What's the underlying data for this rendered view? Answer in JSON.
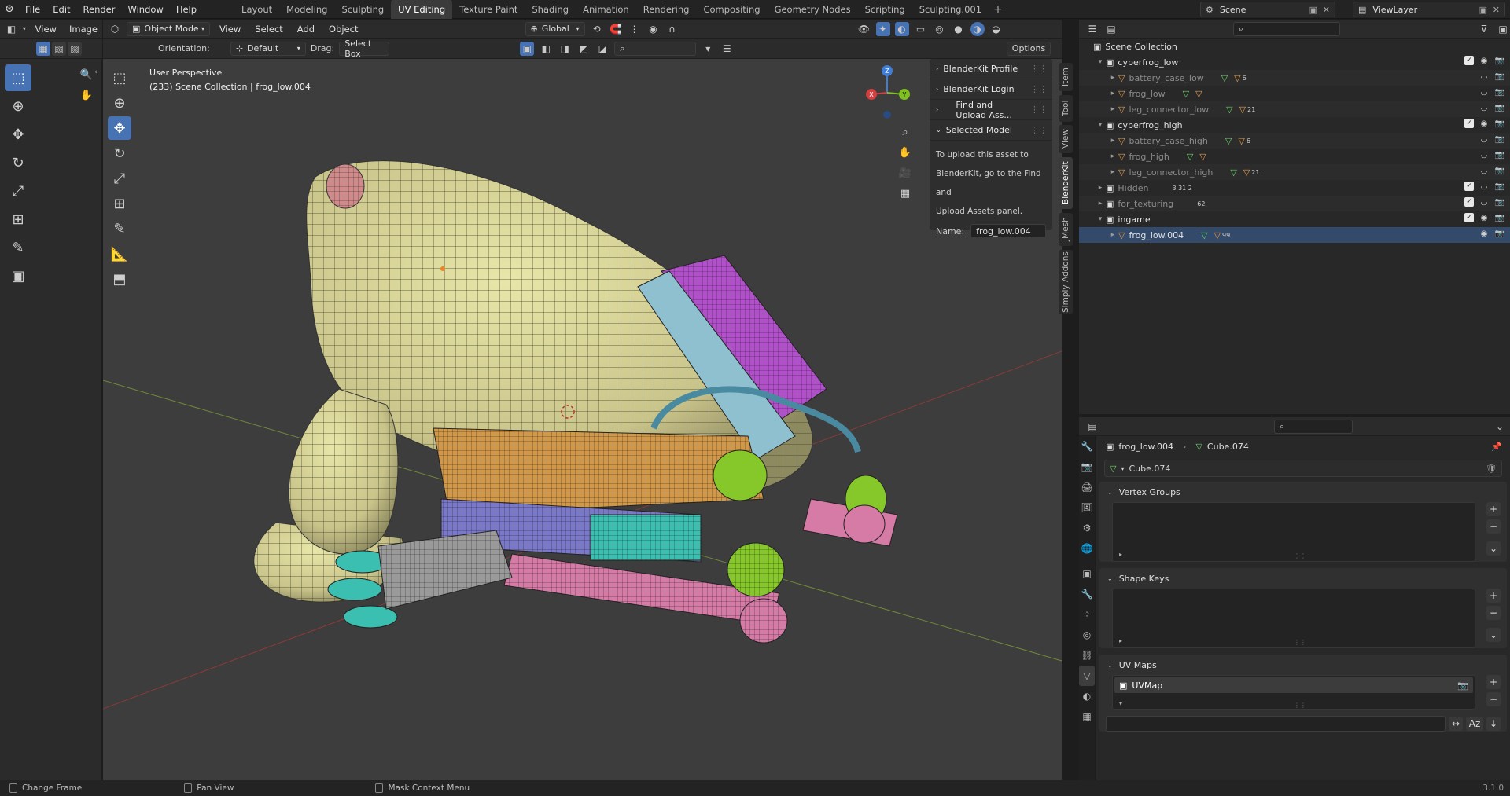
{
  "topbar": {
    "menus": [
      "File",
      "Edit",
      "Render",
      "Window",
      "Help"
    ],
    "workspaces": [
      "Layout",
      "Modeling",
      "Sculpting",
      "UV Editing",
      "Texture Paint",
      "Shading",
      "Animation",
      "Rendering",
      "Compositing",
      "Geometry Nodes",
      "Scripting",
      "Sculpting.001"
    ],
    "active_workspace": "UV Editing",
    "scene": "Scene",
    "view_layer": "ViewLayer"
  },
  "uv_editor": {
    "menus": [
      "View",
      "Image"
    ]
  },
  "viewport": {
    "mode": "Object Mode",
    "menus": [
      "View",
      "Select",
      "Add",
      "Object"
    ],
    "transform_orientation": "Global",
    "orientation_label": "Orientation:",
    "orientation_value": "Default",
    "drag_label": "Drag:",
    "drag_value": "Select Box",
    "options_label": "Options",
    "info_line1": "User Perspective",
    "info_line2": "(233) Scene Collection | frog_low.004",
    "gizmo": {
      "x": "X",
      "y": "Y",
      "z": "Z"
    }
  },
  "npanel": {
    "rows": [
      "BlenderKit Profile",
      "BlenderKit Login",
      "Find and Upload Ass...",
      "Selected Model"
    ],
    "help_lines": [
      "To upload this asset to",
      "BlenderKit, go to the Find and",
      "Upload Assets panel."
    ],
    "name_label": "Name:",
    "name_value": "frog_low.004",
    "tabs": [
      "Item",
      "Tool",
      "View",
      "BlenderKit",
      "JMesh",
      "Simply Addons"
    ],
    "active_tab": "BlenderKit"
  },
  "outliner": {
    "root": "Scene Collection",
    "rows": [
      {
        "label": "cyberfrog_low",
        "type": "collection",
        "indent": 1,
        "dim": false,
        "checked": true
      },
      {
        "label": "battery_case_low",
        "type": "mesh",
        "indent": 2,
        "dim": true,
        "count": "6"
      },
      {
        "label": "frog_low",
        "type": "mesh",
        "indent": 2,
        "dim": true,
        "count": ""
      },
      {
        "label": "leg_connector_low",
        "type": "mesh",
        "indent": 2,
        "dim": true,
        "count": "21"
      },
      {
        "label": "cyberfrog_high",
        "type": "collection",
        "indent": 1,
        "dim": false,
        "checked": true
      },
      {
        "label": "battery_case_high",
        "type": "mesh",
        "indent": 2,
        "dim": true,
        "count": "6"
      },
      {
        "label": "frog_high",
        "type": "mesh",
        "indent": 2,
        "dim": true,
        "count": ""
      },
      {
        "label": "leg_connector_high",
        "type": "mesh",
        "indent": 2,
        "dim": true,
        "count": "21"
      },
      {
        "label": "Hidden",
        "type": "collection",
        "indent": 1,
        "dim": true,
        "checked": true,
        "count": "3  31  2"
      },
      {
        "label": "for_texturing",
        "type": "collection",
        "indent": 1,
        "dim": true,
        "checked": true,
        "count": "62"
      },
      {
        "label": "ingame",
        "type": "collection",
        "indent": 1,
        "dim": false,
        "checked": true
      },
      {
        "label": "frog_low.004",
        "type": "mesh",
        "indent": 2,
        "dim": false,
        "count": "99",
        "selected": true
      }
    ]
  },
  "properties": {
    "object": "frog_low.004",
    "mesh": "Cube.074",
    "datablock": "Cube.074",
    "sections": [
      "Vertex Groups",
      "Shape Keys",
      "UV Maps"
    ],
    "uvmap": "UVMap",
    "sort_label": "Az"
  },
  "statusbar": {
    "items": [
      "Change Frame",
      "Pan View",
      "Mask Context Menu"
    ],
    "version": "3.1.0"
  }
}
